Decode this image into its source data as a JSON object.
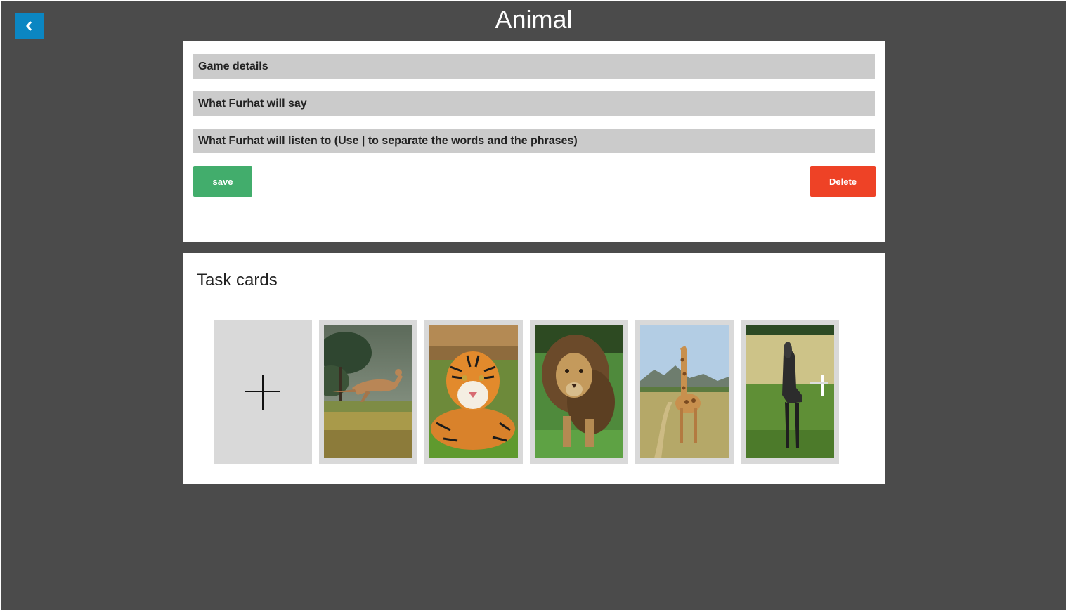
{
  "header": {
    "title": "Animal",
    "back_icon": "chevron-left-icon"
  },
  "details": {
    "sections": [
      {
        "label": "Game details"
      },
      {
        "label": "What Furhat will say"
      },
      {
        "label": "What Furhat will listen to (Use | to separate the words and the phrases)"
      }
    ],
    "save_label": "save",
    "delete_label": "Delete"
  },
  "task_cards": {
    "title": "Task cards",
    "add_icon": "plus-icon",
    "cards": [
      {
        "image": "kangaroo"
      },
      {
        "image": "tiger"
      },
      {
        "image": "lion"
      },
      {
        "image": "giraffe"
      },
      {
        "image": "horse"
      }
    ]
  },
  "colors": {
    "background": "#4b4b4b",
    "back_button": "#0b86c2",
    "section_bar": "#cbcbcb",
    "save": "#42ad6c",
    "delete": "#ee4226",
    "card_frame": "#d9d9d9"
  }
}
